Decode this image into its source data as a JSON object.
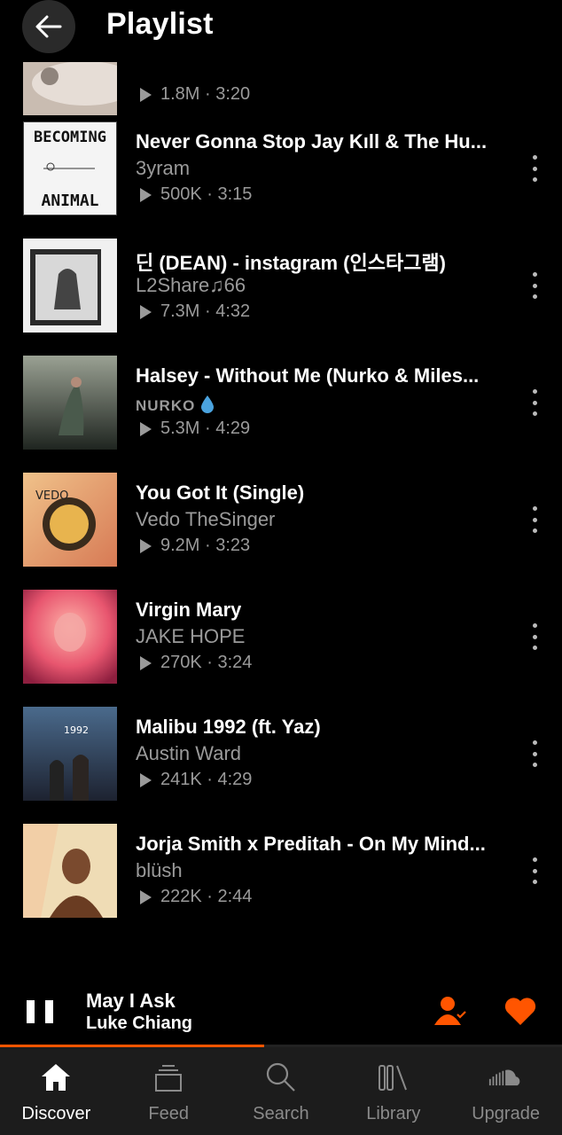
{
  "header": {
    "title": "Playlist",
    "back_icon": "arrow-left-icon"
  },
  "partial_track": {
    "plays": "1.8M",
    "duration": "3:20"
  },
  "tracks": [
    {
      "title": "Never Gonna Stop Jay Kıll & The Hu...",
      "artist": "3yram",
      "plays": "500K",
      "duration": "3:15",
      "art_text_top": "BECOMING",
      "art_text_bottom": "ANIMAL",
      "art_bg": "#f2f2f2"
    },
    {
      "title": "딘 (DEAN) - instagram (인스타그램)",
      "artist": "L2Share♫66",
      "plays": "7.3M",
      "duration": "4:32",
      "art_bg": "#e8e8e8"
    },
    {
      "title": "Halsey - Without Me (Nurko & Miles...",
      "artist": "NURKO",
      "artist_badge": "💧",
      "plays": "5.3M",
      "duration": "4:29",
      "art_bg": "#3b4035"
    },
    {
      "title": "You Got It (Single)",
      "artist": "Vedo TheSinger",
      "plays": "9.2M",
      "duration": "3:23",
      "art_text": "VEDO",
      "art_bg": "#e7a56a"
    },
    {
      "title": "Virgin Mary",
      "artist": "JAKE HOPE",
      "plays": "270K",
      "duration": "3:24",
      "art_bg": "#e85a7a"
    },
    {
      "title": "Malibu 1992 (ft. Yaz)",
      "artist": "Austin Ward",
      "plays": "241K",
      "duration": "4:29",
      "art_text": "1992",
      "art_bg": "#2d3c55"
    },
    {
      "title": "Jorja Smith x Preditah - On My Mind...",
      "artist": "blüsh",
      "plays": "222K",
      "duration": "2:44",
      "art_bg": "#e9d2a8"
    }
  ],
  "mini_player": {
    "title": "May I Ask",
    "artist": "Luke Chiang",
    "progress": 0.47,
    "accent": "#ff5500"
  },
  "nav": [
    {
      "label": "Discover",
      "icon": "home-icon",
      "active": true
    },
    {
      "label": "Feed",
      "icon": "feed-icon",
      "active": false
    },
    {
      "label": "Search",
      "icon": "search-icon",
      "active": false
    },
    {
      "label": "Library",
      "icon": "library-icon",
      "active": false
    },
    {
      "label": "Upgrade",
      "icon": "soundcloud-icon",
      "active": false
    }
  ]
}
